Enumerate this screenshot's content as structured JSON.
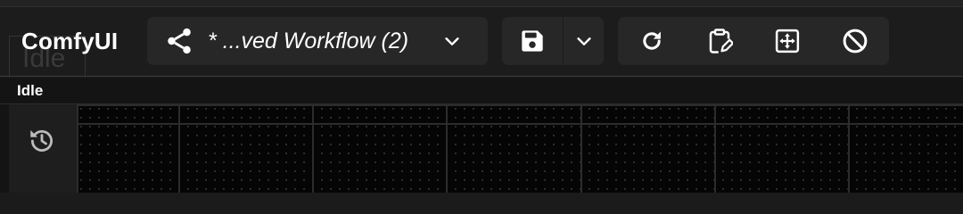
{
  "app": {
    "brand": "ComfyUI",
    "ghost_label": "Idle"
  },
  "workflow": {
    "name": "* ...ved Workflow (2)",
    "icon": "share-nodes-icon",
    "dropdown_icon": "chevron-down-icon"
  },
  "save": {
    "icon": "floppy-disk-icon",
    "dropdown_icon": "chevron-down-icon"
  },
  "actions": [
    {
      "name": "refresh-button",
      "icon": "refresh-icon"
    },
    {
      "name": "clipboard-edit-button",
      "icon": "clipboard-edit-icon"
    },
    {
      "name": "fit-view-button",
      "icon": "fit-view-icon"
    },
    {
      "name": "clear-button",
      "icon": "ban-icon"
    }
  ],
  "status": {
    "label": "Idle"
  },
  "sidebar": {
    "history_icon": "history-icon"
  },
  "colors": {
    "background": "#1b1b1b",
    "pill": "#272727",
    "canvas": "#050505",
    "text": "#ffffff"
  }
}
